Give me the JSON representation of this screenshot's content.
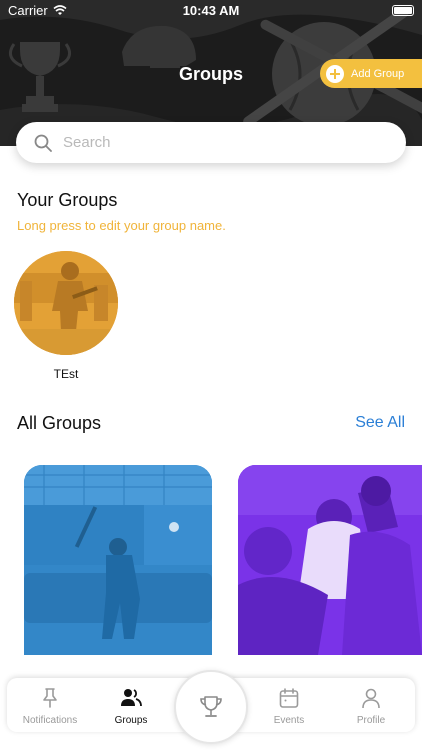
{
  "status_bar": {
    "carrier": "Carrier",
    "time": "10:43 AM"
  },
  "header": {
    "title": "Groups",
    "add_group_label": "Add Group"
  },
  "search": {
    "placeholder": "Search",
    "value": ""
  },
  "your_groups": {
    "title": "Your Groups",
    "hint": "Long press to edit your group name.",
    "items": [
      {
        "name": "TEst"
      }
    ]
  },
  "all_groups": {
    "title": "All Groups",
    "see_all_label": "See All"
  },
  "bottom_nav": {
    "items": [
      {
        "label": "Notifications",
        "icon": "pin-icon",
        "active": false
      },
      {
        "label": "Groups",
        "icon": "users-icon",
        "active": true
      },
      {
        "label": "Events",
        "icon": "calendar-icon",
        "active": false
      },
      {
        "label": "Profile",
        "icon": "person-icon",
        "active": false
      }
    ],
    "center_icon": "trophy-icon"
  },
  "colors": {
    "accent_yellow": "#f3c03f",
    "hint_orange": "#f0b43a",
    "link_blue": "#2b7fd6",
    "card_blue": "#3a8ed0",
    "card_purple": "#7a33e8",
    "header_dark": "#1c1c1c"
  }
}
